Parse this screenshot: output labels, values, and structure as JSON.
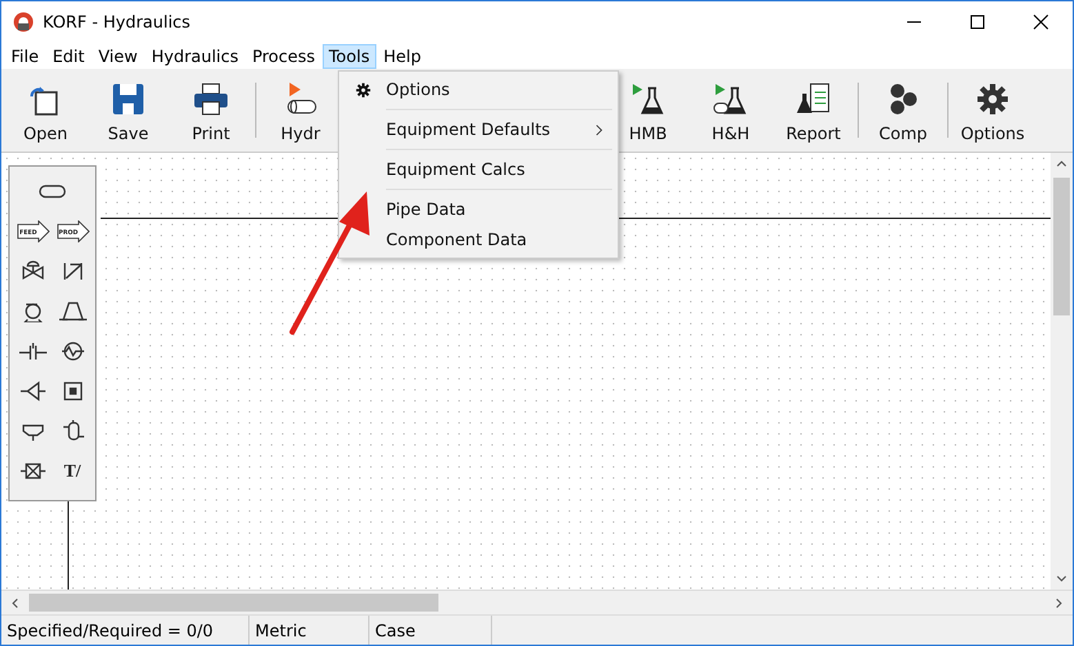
{
  "window": {
    "title": "KORF - Hydraulics"
  },
  "menu_bar": [
    {
      "label": "File",
      "selected": false
    },
    {
      "label": "Edit",
      "selected": false
    },
    {
      "label": "View",
      "selected": false
    },
    {
      "label": "Hydraulics",
      "selected": false
    },
    {
      "label": "Process",
      "selected": false
    },
    {
      "label": "Tools",
      "selected": true
    },
    {
      "label": "Help",
      "selected": false
    }
  ],
  "toolbar": [
    {
      "kind": "button",
      "label": "Open"
    },
    {
      "kind": "button",
      "label": "Save"
    },
    {
      "kind": "button",
      "label": "Print"
    },
    {
      "kind": "separator"
    },
    {
      "kind": "button",
      "label": "Hydr"
    },
    {
      "kind": "gap"
    },
    {
      "kind": "button",
      "label": "HMB"
    },
    {
      "kind": "button",
      "label": "H&H"
    },
    {
      "kind": "button",
      "label": "Report"
    },
    {
      "kind": "separator"
    },
    {
      "kind": "button",
      "label": "Comp"
    },
    {
      "kind": "separator"
    },
    {
      "kind": "button",
      "label": "Options"
    }
  ],
  "tools_menu": [
    {
      "kind": "icon_item",
      "label": "Options"
    },
    {
      "kind": "submenu",
      "label": "Equipment Defaults"
    },
    {
      "kind": "item",
      "label": "Equipment Calcs"
    },
    {
      "kind": "item",
      "label": "Pipe Data"
    },
    {
      "kind": "item",
      "label": "Component Data"
    }
  ],
  "palette": [
    {
      "kind": "pipe"
    },
    {
      "kind": "feed",
      "label": "FEED"
    },
    {
      "kind": "prod",
      "label": "PROD"
    },
    {
      "kind": "valve"
    },
    {
      "kind": "check"
    },
    {
      "kind": "pump"
    },
    {
      "kind": "compressor"
    },
    {
      "kind": "orifice"
    },
    {
      "kind": "exchanger"
    },
    {
      "kind": "reducer"
    },
    {
      "kind": "misc"
    },
    {
      "kind": "tee"
    },
    {
      "kind": "vessel"
    },
    {
      "kind": "filter"
    },
    {
      "kind": "text",
      "label": "T/"
    }
  ],
  "status_bar": [
    "Specified/Required = 0/0",
    "Metric",
    "Case"
  ]
}
